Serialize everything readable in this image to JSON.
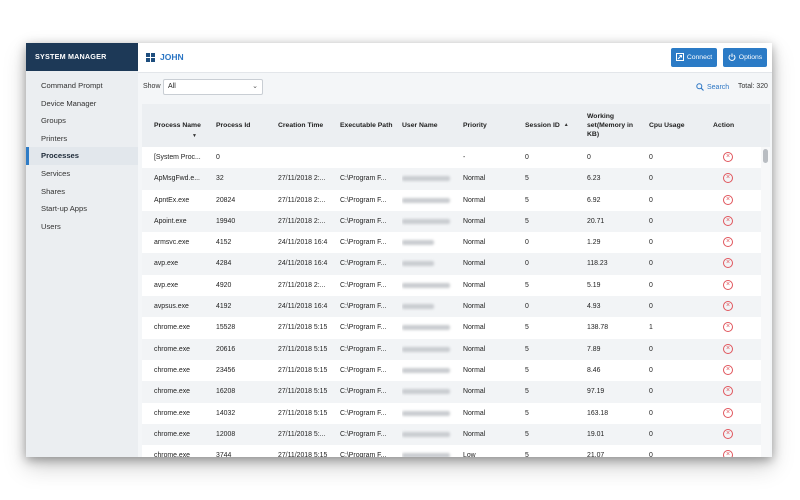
{
  "sidebar": {
    "title": "SYSTEM MANAGER",
    "items": [
      {
        "label": "Command Prompt"
      },
      {
        "label": "Device Manager"
      },
      {
        "label": "Groups"
      },
      {
        "label": "Printers"
      },
      {
        "label": "Processes",
        "active": true
      },
      {
        "label": "Services"
      },
      {
        "label": "Shares"
      },
      {
        "label": "Start-up Apps"
      },
      {
        "label": "Users"
      }
    ]
  },
  "topbar": {
    "host_icon": "windows-icon",
    "host": "JOHN",
    "connect_label": "Connect",
    "connect_icon": "connect-icon",
    "options_label": "Options",
    "options_icon": "power-icon"
  },
  "controls": {
    "show_label": "Show",
    "show_value": "All",
    "search_label": "Search",
    "total": "Total: 320"
  },
  "table": {
    "headers": {
      "name": "Process Name",
      "pid": "Process Id",
      "time": "Creation Time",
      "path": "Executable Path",
      "user": "User Name",
      "priority": "Priority",
      "session": "Session ID",
      "memory": "Working set(Memory in KB)",
      "cpu": "Cpu Usage",
      "action": "Action"
    },
    "rows": [
      {
        "name": "[System Proc...",
        "pid": "0",
        "time": "",
        "path": "",
        "user": "",
        "priority": "-",
        "session": "0",
        "memory": "0",
        "cpu": "0"
      },
      {
        "name": "ApMsgFwd.e...",
        "pid": "32",
        "time": "27/11/2018 2:...",
        "path": "C:\\Program F...",
        "user": "krishnan 4780",
        "priority": "Normal",
        "session": "5",
        "memory": "6.23",
        "cpu": "0"
      },
      {
        "name": "ApntEx.exe",
        "pid": "20824",
        "time": "27/11/2018 2:...",
        "path": "C:\\Program F...",
        "user": "krishnan 4780",
        "priority": "Normal",
        "session": "5",
        "memory": "6.92",
        "cpu": "0"
      },
      {
        "name": "Apoint.exe",
        "pid": "19940",
        "time": "27/11/2018 2:...",
        "path": "C:\\Program F...",
        "user": "krishnan 4780",
        "priority": "Normal",
        "session": "5",
        "memory": "20.71",
        "cpu": "0"
      },
      {
        "name": "armsvc.exe",
        "pid": "4152",
        "time": "24/11/2018 16:4",
        "path": "C:\\Program F...",
        "user": "SYSTEM",
        "priority": "Normal",
        "session": "0",
        "memory": "1.29",
        "cpu": "0"
      },
      {
        "name": "avp.exe",
        "pid": "4284",
        "time": "24/11/2018 16:4",
        "path": "C:\\Program F...",
        "user": "SYSTEM",
        "priority": "Normal",
        "session": "0",
        "memory": "118.23",
        "cpu": "0"
      },
      {
        "name": "avp.exe",
        "pid": "4920",
        "time": "27/11/2018 2:...",
        "path": "C:\\Program F...",
        "user": "krishnan 4780",
        "priority": "Normal",
        "session": "5",
        "memory": "5.19",
        "cpu": "0"
      },
      {
        "name": "avpsus.exe",
        "pid": "4192",
        "time": "24/11/2018 16:4",
        "path": "C:\\Program F...",
        "user": "SYSTEM",
        "priority": "Normal",
        "session": "0",
        "memory": "4.93",
        "cpu": "0"
      },
      {
        "name": "chrome.exe",
        "pid": "15528",
        "time": "27/11/2018 5:15",
        "path": "C:\\Program F...",
        "user": "krishnan 4780",
        "priority": "Normal",
        "session": "5",
        "memory": "138.78",
        "cpu": "1"
      },
      {
        "name": "chrome.exe",
        "pid": "20616",
        "time": "27/11/2018 5:15",
        "path": "C:\\Program F...",
        "user": "krishnan 4780",
        "priority": "Normal",
        "session": "5",
        "memory": "7.89",
        "cpu": "0"
      },
      {
        "name": "chrome.exe",
        "pid": "23456",
        "time": "27/11/2018 5:15",
        "path": "C:\\Program F...",
        "user": "krishnan 4780",
        "priority": "Normal",
        "session": "5",
        "memory": "8.46",
        "cpu": "0"
      },
      {
        "name": "chrome.exe",
        "pid": "16208",
        "time": "27/11/2018 5:15",
        "path": "C:\\Program F...",
        "user": "krishnan 4780",
        "priority": "Normal",
        "session": "5",
        "memory": "97.19",
        "cpu": "0"
      },
      {
        "name": "chrome.exe",
        "pid": "14032",
        "time": "27/11/2018 5:15",
        "path": "C:\\Program F...",
        "user": "krishnan 4780",
        "priority": "Normal",
        "session": "5",
        "memory": "163.18",
        "cpu": "0"
      },
      {
        "name": "chrome.exe",
        "pid": "12008",
        "time": "27/11/2018 5:...",
        "path": "C:\\Program F...",
        "user": "krishnan 4780",
        "priority": "Normal",
        "session": "5",
        "memory": "19.01",
        "cpu": "0"
      },
      {
        "name": "chrome.exe",
        "pid": "3744",
        "time": "27/11/2018 5:15",
        "path": "C:\\Program F...",
        "user": "krishnan 4780",
        "priority": "Low",
        "session": "5",
        "memory": "21.07",
        "cpu": "0"
      }
    ]
  }
}
